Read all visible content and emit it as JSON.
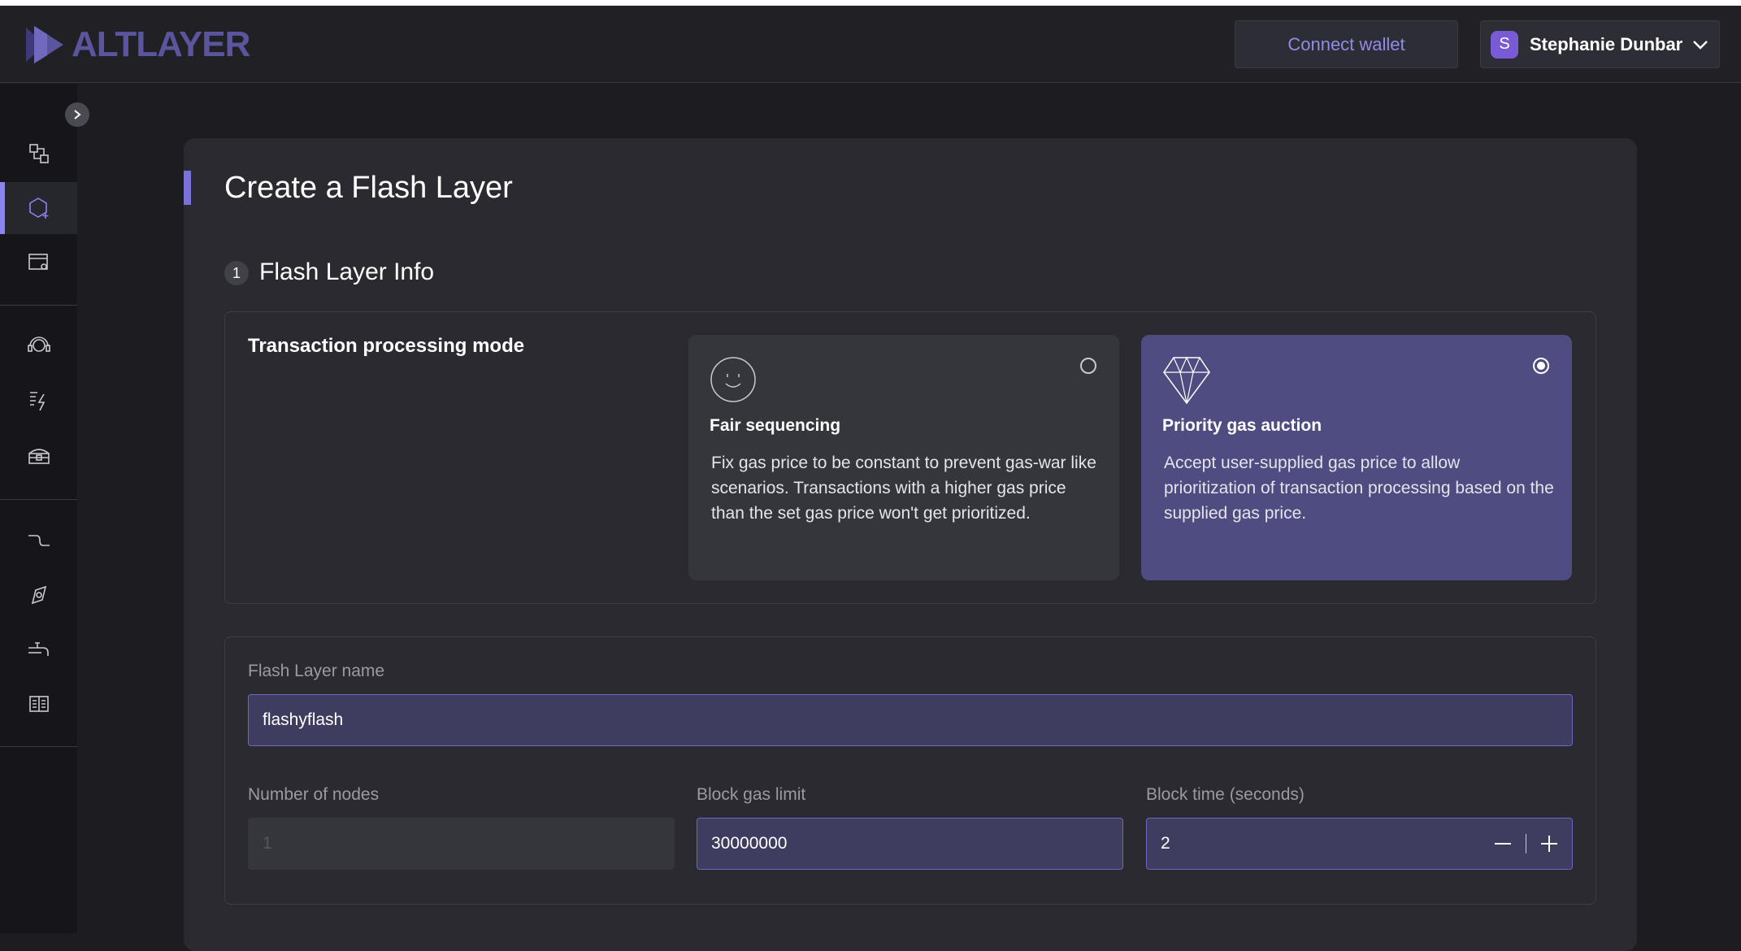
{
  "brand": {
    "name": "ALTLAYER"
  },
  "header": {
    "connect_wallet": "Connect wallet",
    "user": {
      "initial": "S",
      "name": "Stephanie Dunbar"
    }
  },
  "sidebar": {
    "items": [
      {
        "icon": "bridge-icon"
      },
      {
        "icon": "create-layer-icon",
        "active": true
      },
      {
        "icon": "layer-settings-icon"
      },
      {
        "icon": "support-icon"
      },
      {
        "icon": "flash-stats-icon"
      },
      {
        "icon": "treasure-icon"
      },
      {
        "icon": "route-icon"
      },
      {
        "icon": "explorer-icon"
      },
      {
        "icon": "faucet-icon"
      },
      {
        "icon": "docs-icon"
      }
    ]
  },
  "page": {
    "title": "Create a Flash Layer",
    "step": {
      "number": "1",
      "title": "Flash Layer Info"
    }
  },
  "mode": {
    "label": "Transaction processing mode",
    "options": [
      {
        "title": "Fair sequencing",
        "description": "Fix gas price to be constant to prevent gas-war like scenarios. Transactions with a higher gas price than the set gas price won't get prioritized.",
        "icon": "smiley-icon",
        "selected": false
      },
      {
        "title": "Priority gas auction",
        "description": "Accept user-supplied gas price to allow prioritization of transaction processing based on the supplied gas price.",
        "icon": "diamond-icon",
        "selected": true
      }
    ]
  },
  "fields": {
    "name": {
      "label": "Flash Layer name",
      "value": "flashyflash"
    },
    "nodes": {
      "label": "Number of nodes",
      "value": "1"
    },
    "gas_limit": {
      "label": "Block gas limit",
      "value": "30000000"
    },
    "block_time": {
      "label": "Block time (seconds)",
      "value": "2"
    }
  },
  "colors": {
    "accent": "#8b83f0",
    "selected_card": "#4e4c80",
    "background": "#1c1c21"
  }
}
